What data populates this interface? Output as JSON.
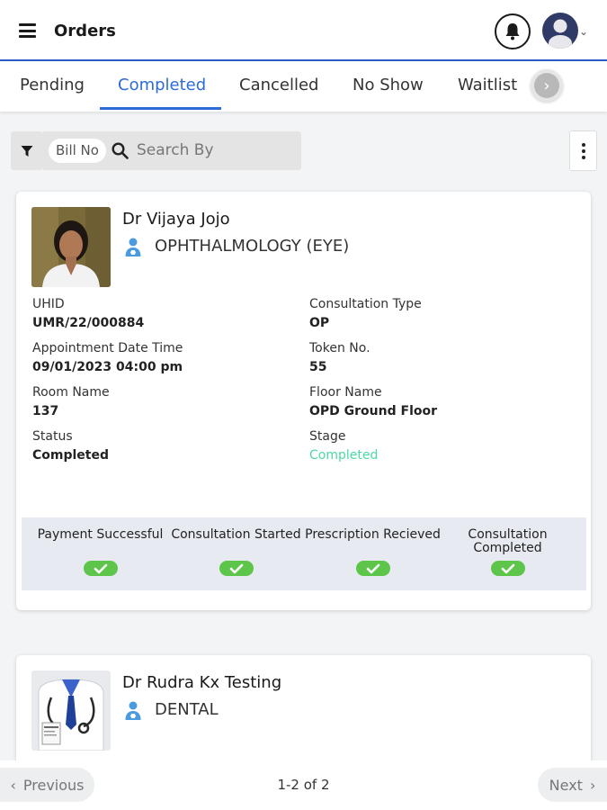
{
  "header": {
    "title": "Orders",
    "menu_icon": "hamburger-icon",
    "bell_icon": "bell-icon",
    "avatar_icon": "user-avatar-icon"
  },
  "tabs": {
    "items": [
      {
        "label": "Pending",
        "active": false
      },
      {
        "label": "Completed",
        "active": true
      },
      {
        "label": "Cancelled",
        "active": false
      },
      {
        "label": "No Show",
        "active": false
      },
      {
        "label": "Waitlist",
        "active": false
      }
    ],
    "accent_color": "#2d6bd6"
  },
  "toolbar": {
    "filter_icon": "filter-icon",
    "bill_chip": "Bill No",
    "search_placeholder": "Search By",
    "search_value": ""
  },
  "orders": [
    {
      "doctor": "Dr Vijaya Jojo",
      "department": "OPHTHALMOLOGY (EYE)",
      "fields": {
        "uhid_label": "UHID",
        "uhid": "UMR/22/000884",
        "consult_type_label": "Consultation Type",
        "consult_type": "OP",
        "appt_label": "Appointment Date Time",
        "appt": "09/01/2023 04:00 pm",
        "token_label": "Token No.",
        "token": "55",
        "room_label": "Room Name",
        "room": "137",
        "floor_label": "Floor Name",
        "floor": "OPD Ground Floor",
        "status_label": "Status",
        "status": "Completed",
        "stage_label": "Stage",
        "stage": "Completed"
      },
      "steps": [
        {
          "label": "Payment Successful",
          "done": true
        },
        {
          "label": "Consultation Started",
          "done": true
        },
        {
          "label": "Prescription Recieved",
          "done": true
        },
        {
          "label": "Consultation Completed",
          "done": true
        }
      ]
    },
    {
      "doctor": "Dr Rudra Kx Testing",
      "department": "DENTAL"
    }
  ],
  "pagination": {
    "previous": "Previous",
    "next": "Next",
    "count": "1-2 of 2"
  },
  "colors": {
    "stage_green": "#4cd9a2",
    "check_green": "#5cc54a",
    "progress_bg": "#e7eaf0"
  }
}
